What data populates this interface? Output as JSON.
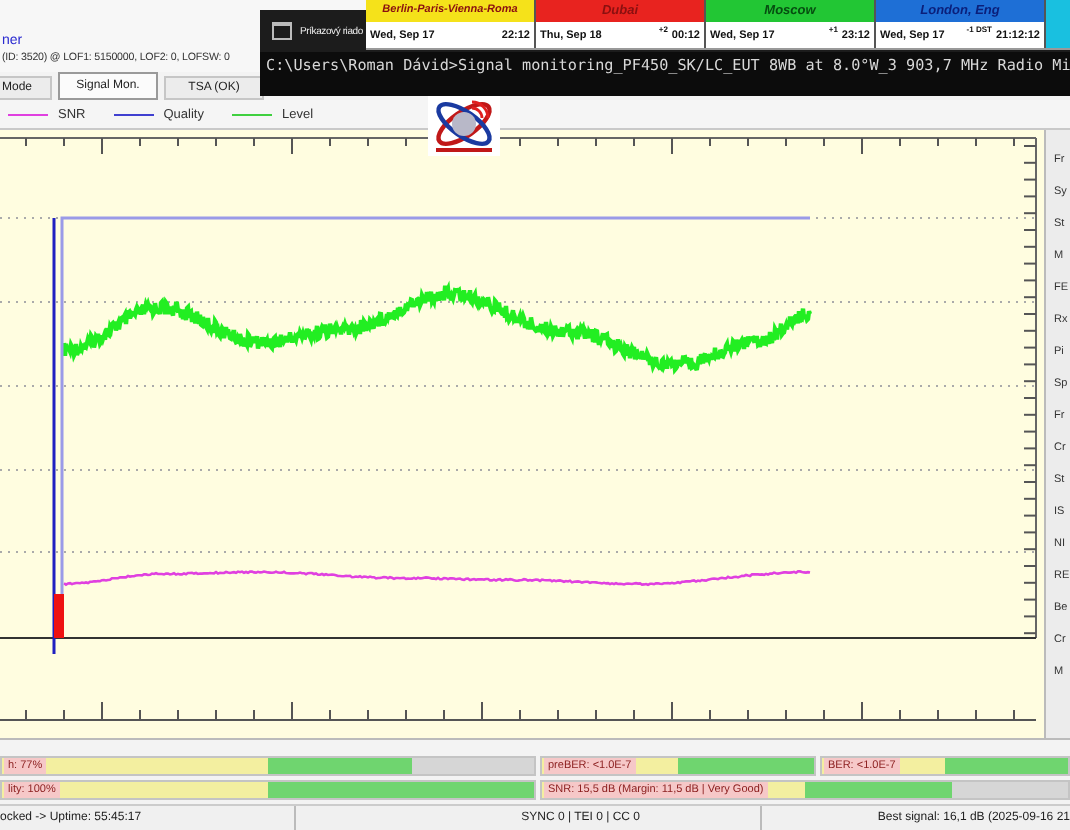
{
  "app": {
    "title": "ner",
    "info": "(ID: 3520) @ LOF1: 5150000, LOF2: 0, LOFSW: 0"
  },
  "tabs": [
    {
      "label": "Mode",
      "selected": false
    },
    {
      "label": "Signal Mon.",
      "selected": true
    },
    {
      "label": "TSA (OK)",
      "selected": false
    }
  ],
  "legend": [
    {
      "label": "SNR",
      "color": "#e040e0"
    },
    {
      "label": "Quality",
      "color": "#4040d0"
    },
    {
      "label": "Level",
      "color": "#40d040"
    }
  ],
  "side_labels": [
    "Fr",
    "Sy",
    "St",
    "M",
    "FE",
    "Rx",
    "Pi",
    "Sp",
    "Fr",
    "Cr",
    "St",
    "IS",
    "NI",
    "RE",
    "Be",
    "Cr",
    "M"
  ],
  "meters": [
    [
      {
        "label": "h: 77%",
        "level": 0.77
      },
      {
        "label": "preBER: <1.0E-7",
        "level": 1
      },
      {
        "label": "BER: <1.0E-7",
        "level": 1
      }
    ],
    [
      {
        "label": "lity: 100%",
        "level": 1
      },
      {
        "label": "SNR: 15,5 dB (Margin: 11,5 dB | Very Good)",
        "level": 0.78
      }
    ]
  ],
  "status_bar": [
    "ocked -> Uptime: 55:45:17",
    "SYNC 0 | TEI 0 | CC 0",
    "Best signal: 16,1 dB (2025-09-16 21"
  ],
  "command_window": {
    "title": "Príkazový riado",
    "line": "C:\\Users\\Roman Dávid>Signal monitoring_PF450_SK/LC_EUT 8WB at 8.0°W_3 903,7 MHz Radio Mi"
  },
  "world_clock": [
    {
      "city": "Berlin-Paris-Vienna-Roma",
      "color": "#f5e21a",
      "date": "Wed, Sep 17",
      "time": "22:12"
    },
    {
      "city": "Dubai",
      "color": "#e8231f",
      "date": "Thu, Sep 18",
      "offset": "+2",
      "time": "00:12"
    },
    {
      "city": "Moscow",
      "color": "#22c634",
      "date": "Wed, Sep 17",
      "offset": "+1",
      "time": "23:12"
    },
    {
      "city": "London, Eng",
      "color": "#1e6fd6",
      "date": "Wed, Sep 17",
      "offset": "-1 DST",
      "time": "21:12:12"
    }
  ]
}
